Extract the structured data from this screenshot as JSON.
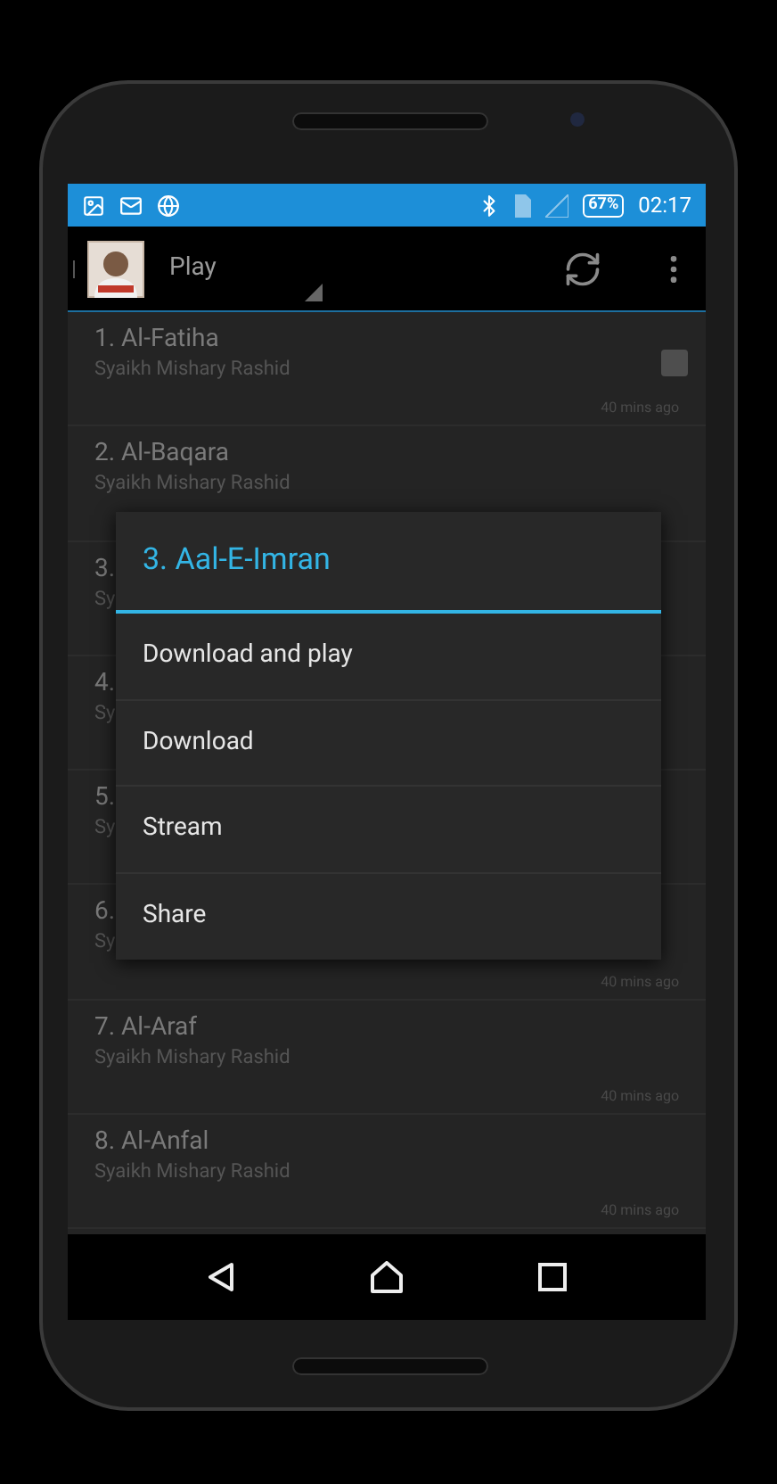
{
  "status_bar": {
    "battery": "67%",
    "time": "02:17"
  },
  "action_bar": {
    "title": "Play"
  },
  "tracks": [
    {
      "title": "1. Al-Fatiha",
      "artist": "Syaikh Mishary Rashid",
      "time": "40 mins ago",
      "checkbox": {
        "checked": false
      }
    },
    {
      "title": "2. Al-Baqara",
      "artist": "Syaikh Mishary Rashid"
    },
    {
      "title": "3.",
      "artist": "Sy"
    },
    {
      "title": "4.",
      "artist": "Sy"
    },
    {
      "title": "5.",
      "artist": "Sy"
    },
    {
      "title": "6.",
      "artist": "Sy",
      "time": "40 mins ago"
    },
    {
      "title": "7. Al-Araf",
      "artist": "Syaikh Mishary Rashid",
      "time": "40 mins ago"
    },
    {
      "title": "8. Al-Anfal",
      "artist": "Syaikh Mishary Rashid",
      "time": "40 mins ago"
    }
  ],
  "dialog": {
    "title": "3. Aal-E-Imran",
    "options": [
      "Download and play",
      "Download",
      "Stream",
      "Share"
    ]
  }
}
